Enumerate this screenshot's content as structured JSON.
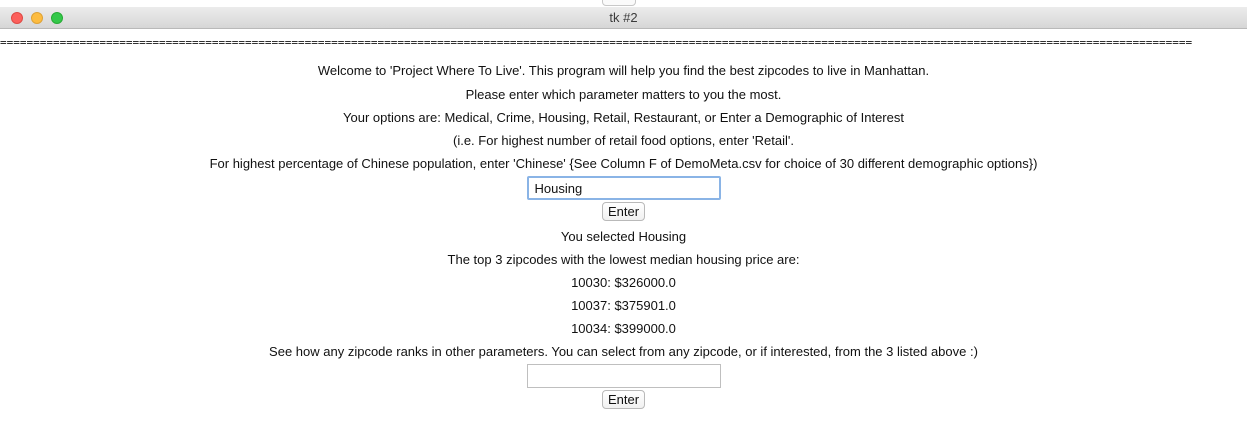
{
  "window": {
    "title": "tk #2",
    "separator": "===================================================================================================================================================================================="
  },
  "intro": {
    "welcome": "Welcome to 'Project Where To Live'. This program will help you find the best zipcodes to live in Manhattan.",
    "prompt": "Please enter which parameter matters to you the most.",
    "options": "Your options are: Medical, Crime, Housing, Retail, Restaurant, or Enter a Demographic of Interest",
    "example_retail": "(i.e. For highest number of retail food options, enter 'Retail'.",
    "example_demographic": "For highest percentage of Chinese population, enter 'Chinese' {See Column F of DemoMeta.csv for choice of 30 different demographic options})"
  },
  "parameter_input": {
    "value": "Housing"
  },
  "buttons": {
    "enter_label": "Enter"
  },
  "results": {
    "selected": "You selected Housing",
    "heading": "The top 3 zipcodes with the lowest median housing price are:",
    "zipcodes": [
      "10030: $326000.0",
      "10037: $375901.0",
      "10034: $399000.0"
    ]
  },
  "followup": {
    "prompt": "See how any zipcode ranks in other parameters. You can select from any zipcode, or if interested, from the 3 listed above :)",
    "value": ""
  },
  "colors": {
    "close": "#fc605c",
    "minimize": "#fdbc40",
    "zoom": "#34c84a",
    "focus_ring": "#8ab4e6"
  }
}
